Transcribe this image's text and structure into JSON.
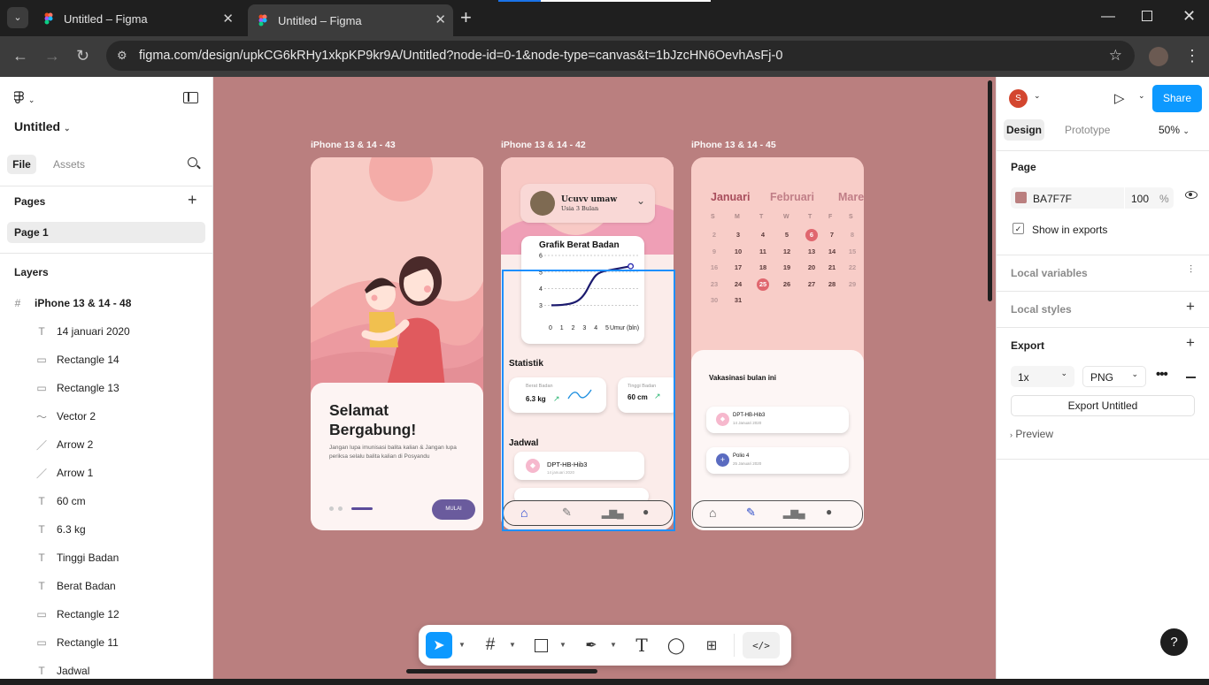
{
  "browser": {
    "tabs": [
      {
        "title": "Untitled – Figma"
      },
      {
        "title": "Untitled – Figma"
      }
    ],
    "url": "figma.com/design/upkCG6kRHy1xkpKP9kr9A/Untitled?node-id=0-1&node-type=canvas&t=1bJzcHN6OevhAsFj-0",
    "new_tab": "+"
  },
  "left": {
    "file_name": "Untitled",
    "tabs": [
      "File",
      "Assets"
    ],
    "pages_title": "Pages",
    "page": "Page 1",
    "layers_title": "Layers",
    "frame": "iPhone 13 & 14 - 48",
    "layers": [
      {
        "icon": "T",
        "name": "14 januari 2020"
      },
      {
        "icon": "▭",
        "name": "Rectangle 14"
      },
      {
        "icon": "▭",
        "name": "Rectangle 13"
      },
      {
        "icon": "〜",
        "name": "Vector 2"
      },
      {
        "icon": "／",
        "name": "Arrow 2"
      },
      {
        "icon": "／",
        "name": "Arrow 1"
      },
      {
        "icon": "T",
        "name": "60 cm"
      },
      {
        "icon": "T",
        "name": "6.3 kg"
      },
      {
        "icon": "T",
        "name": "Tinggi Badan"
      },
      {
        "icon": "T",
        "name": "Berat Badan"
      },
      {
        "icon": "▭",
        "name": "Rectangle 12"
      },
      {
        "icon": "▭",
        "name": "Rectangle 11"
      },
      {
        "icon": "T",
        "name": "Jadwal"
      }
    ]
  },
  "canvas": {
    "bg": "#BA7F7F",
    "frame_labels": [
      "iPhone 13 & 14 - 43",
      "iPhone 13 & 14 - 42",
      "iPhone 13 & 14 - 45"
    ],
    "welcome": {
      "title_line1": "Selamat",
      "title_line2": "Bergabung!",
      "body": "Jangan lupa imunisasi balita kalian & Jangan lupa periksa selalu balita kalian di Posyandu",
      "button": "MULAI"
    },
    "home": {
      "name": "Ucuvv umaw",
      "age": "Usia 3 Bulan",
      "graph_title": "Grafik Berat Badan",
      "y_ticks": [
        "6",
        "5",
        "4",
        "3"
      ],
      "x_ticks": [
        "0",
        "1",
        "2",
        "3",
        "4",
        "5"
      ],
      "x_unit": "Umur (bln)",
      "statistik": "Statistik",
      "berat_label": "Berat Badan",
      "berat_value": "6.3 kg",
      "tinggi_label": "Tinggi Badan",
      "tinggi_value": "60 cm",
      "jadwal": "Jadwal",
      "jadwal_item": "DPT-HB-Hib3",
      "jadwal_date": "14 januari 2020"
    },
    "calendar": {
      "months": [
        "Januari",
        "Februari",
        "Maret"
      ],
      "weekdays": [
        "S",
        "M",
        "T",
        "W",
        "T",
        "F",
        "S"
      ],
      "rows": [
        [
          "2",
          "3",
          "4",
          "5",
          "6",
          "7",
          "8"
        ],
        [
          "9",
          "10",
          "11",
          "12",
          "13",
          "14",
          "15"
        ],
        [
          "16",
          "17",
          "18",
          "19",
          "20",
          "21",
          "22"
        ],
        [
          "23",
          "24",
          "25",
          "26",
          "27",
          "28",
          "29"
        ],
        [
          "30",
          "31",
          "",
          "",
          "",
          "",
          ""
        ]
      ],
      "section": "Vakasinasi bulan ini",
      "items": [
        {
          "name": "DPT-HB-Hib3",
          "date": "14 Januari 2020"
        },
        {
          "name": "Polio 4",
          "date": "25 Januari 2020"
        }
      ]
    }
  },
  "right": {
    "avatar": "S",
    "share": "Share",
    "tabs": [
      "Design",
      "Prototype"
    ],
    "zoom": "50%",
    "page_title": "Page",
    "color": "BA7F7F",
    "opacity": "100",
    "percent": "%",
    "show_exports": "Show in exports",
    "local_variables": "Local variables",
    "local_styles": "Local styles",
    "export_title": "Export",
    "scale": "1x",
    "format": "PNG",
    "export_button": "Export Untitled",
    "preview": "Preview"
  },
  "help": "?"
}
